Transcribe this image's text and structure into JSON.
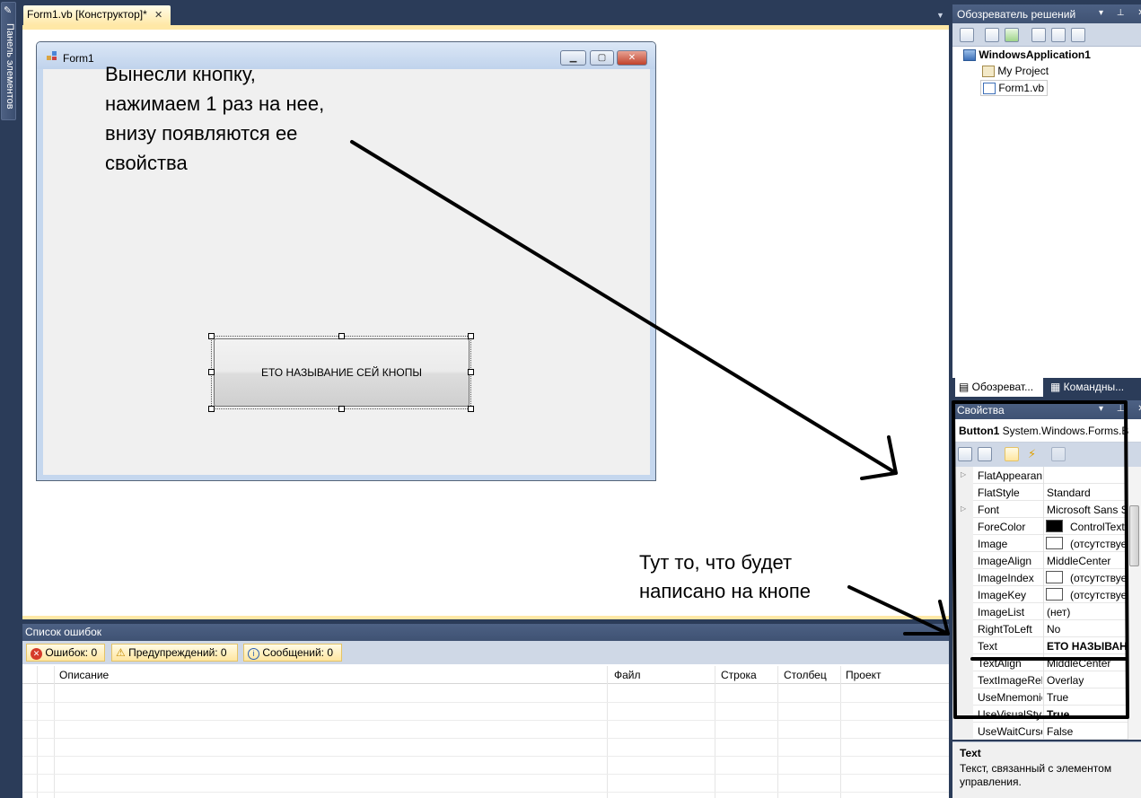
{
  "toolbox": {
    "label": "Панель элементов"
  },
  "document_tab": {
    "label": "Form1.vb [Конструктор]*",
    "close": "✕"
  },
  "form": {
    "title": "Form1",
    "button_text": "ЕТО НАЗЫВАНИЕ СЕЙ КНОПЫ",
    "caption_buttons": [
      "▁",
      "▢",
      "✕"
    ]
  },
  "annotations": {
    "top": [
      "Вынесли кнопку,",
      "нажимаем 1 раз на нее,",
      "внизу появляются ее",
      "свойства"
    ],
    "bottom": [
      "Тут то, что будет",
      "написано на кнопе"
    ]
  },
  "solution_explorer": {
    "title": "Обозреватель решений",
    "header_icons": "▾ ⊥ ✕",
    "items": [
      "WindowsApplication1",
      "My Project",
      "Form1.vb"
    ],
    "tabs": [
      "Обозреват...",
      "Командны..."
    ]
  },
  "properties": {
    "title": "Свойства",
    "header_icons": "▾ ⊥ ✕",
    "object_name": "Button1",
    "object_type": "System.Windows.Forms.B",
    "rows": [
      {
        "name": "FlatAppearance",
        "value": "",
        "expander": "▷"
      },
      {
        "name": "FlatStyle",
        "value": "Standard",
        "expander": ""
      },
      {
        "name": "Font",
        "value": "Microsoft Sans S",
        "expander": "▷"
      },
      {
        "name": "ForeColor",
        "value": "ControlText",
        "expander": ""
      },
      {
        "name": "Image",
        "value": "(отсутствует)",
        "expander": ""
      },
      {
        "name": "ImageAlign",
        "value": "MiddleCenter",
        "expander": ""
      },
      {
        "name": "ImageIndex",
        "value": "(отсутствует)",
        "expander": ""
      },
      {
        "name": "ImageKey",
        "value": "(отсутствует)",
        "expander": ""
      },
      {
        "name": "ImageList",
        "value": "(нет)",
        "expander": ""
      },
      {
        "name": "RightToLeft",
        "value": "No",
        "expander": ""
      },
      {
        "name": "Text",
        "value": "ЕТО НАЗЫВАН",
        "expander": ""
      },
      {
        "name": "TextAlign",
        "value": "MiddleCenter",
        "expander": ""
      },
      {
        "name": "TextImageRel",
        "value": "Overlay",
        "expander": ""
      },
      {
        "name": "UseMnemonic",
        "value": "True",
        "expander": ""
      },
      {
        "name": "UseVisualStyle",
        "value": "True",
        "expander": ""
      },
      {
        "name": "UseWaitCursor",
        "value": "False",
        "expander": ""
      }
    ],
    "description_title": "Text",
    "description_text": "Текст, связанный с элементом управления."
  },
  "error_list": {
    "title": "Список ошибок",
    "errors": "Ошибок: 0",
    "warnings": "Предупреждений: 0",
    "messages": "Сообщений: 0",
    "columns": [
      "Описание",
      "Файл",
      "Строка",
      "Столбец",
      "Проект"
    ]
  },
  "colors": {
    "ide_background": "#2b3c59",
    "active_tab": "#ffe8a6",
    "panel_header": "#4d6184",
    "annotation_ink": "#000000"
  }
}
